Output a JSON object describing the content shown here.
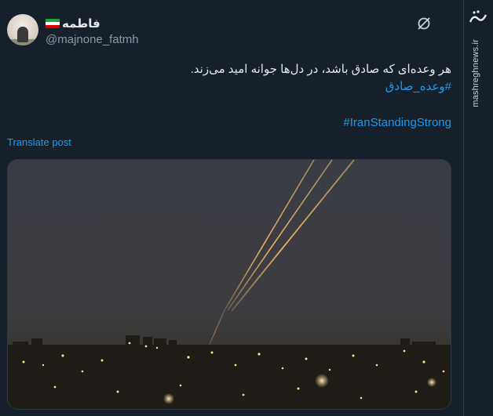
{
  "tweet": {
    "display_name": "فاطمه",
    "handle": "@majnone_fatmh",
    "text_line": "هر وعده‌ای که صادق باشد، در دل‌ها جوانه امید می‌زند.",
    "hashtag_fa": "#وعده_صادق",
    "hashtag_en": "#IranStandingStrong",
    "translate_label": "Translate post"
  },
  "watermark": {
    "site": "mashreghnews.ir",
    "logo_text": "مشرق"
  },
  "icons": {
    "flag": "iran-flag-icon",
    "grok": "grok-icon",
    "avatar": "avatar"
  },
  "colors": {
    "background": "#15202b",
    "link": "#1d9bf0",
    "text": "#e7e9ea",
    "muted": "#8b98a5"
  }
}
